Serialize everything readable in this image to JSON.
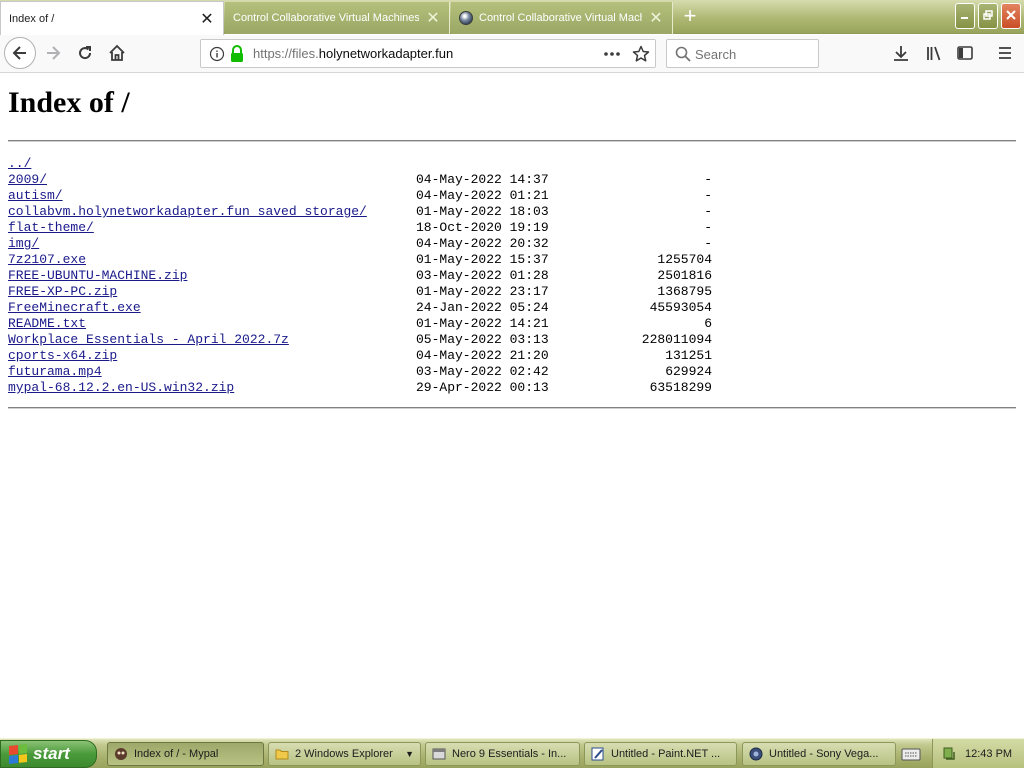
{
  "browser": {
    "tabs": [
      {
        "label": "Index of /",
        "active": true
      },
      {
        "label": "Control Collaborative Virtual Machines!",
        "active": false
      },
      {
        "label": "Control Collaborative Virtual Machines!",
        "active": false
      }
    ],
    "url_scheme": "https://files.",
    "url_domain": "holynetworkadapter.fun",
    "search_placeholder": "Search",
    "accent_color": "#98a45c"
  },
  "page": {
    "title": "Index of /",
    "entries": [
      {
        "name": "../",
        "date": "",
        "size": ""
      },
      {
        "name": "2009/",
        "date": "04-May-2022 14:37",
        "size": "-"
      },
      {
        "name": "autism/",
        "date": "04-May-2022 01:21",
        "size": "-"
      },
      {
        "name": "collabvm.holynetworkadapter.fun saved storage/",
        "date": "01-May-2022 18:03",
        "size": "-"
      },
      {
        "name": "flat-theme/",
        "date": "18-Oct-2020 19:19",
        "size": "-"
      },
      {
        "name": "img/",
        "date": "04-May-2022 20:32",
        "size": "-"
      },
      {
        "name": "7z2107.exe",
        "date": "01-May-2022 15:37",
        "size": "1255704"
      },
      {
        "name": "FREE-UBUNTU-MACHINE.zip",
        "date": "03-May-2022 01:28",
        "size": "2501816"
      },
      {
        "name": "FREE-XP-PC.zip",
        "date": "01-May-2022 23:17",
        "size": "1368795"
      },
      {
        "name": "FreeMinecraft.exe",
        "date": "24-Jan-2022 05:24",
        "size": "45593054"
      },
      {
        "name": "README.txt",
        "date": "01-May-2022 14:21",
        "size": "6"
      },
      {
        "name": "Workplace Essentials - April 2022.7z",
        "date": "05-May-2022 03:13",
        "size": "228011094"
      },
      {
        "name": "cports-x64.zip",
        "date": "04-May-2022 21:20",
        "size": "131251"
      },
      {
        "name": "futurama.mp4",
        "date": "03-May-2022 02:42",
        "size": "629924"
      },
      {
        "name": "mypal-68.12.2.en-US.win32.zip",
        "date": "29-Apr-2022 00:13",
        "size": "63518299"
      }
    ]
  },
  "taskbar": {
    "start_label": "start",
    "items": [
      {
        "label": "Index of / - Mypal",
        "icon": "mypal-icon",
        "active": true
      },
      {
        "label": "2 Windows Explorer",
        "icon": "folder-icon",
        "active": false
      },
      {
        "label": "Nero 9 Essentials - In...",
        "icon": "nero-icon",
        "active": false
      },
      {
        "label": "Untitled - Paint.NET ...",
        "icon": "paintnet-icon",
        "active": false
      },
      {
        "label": "Untitled - Sony Vega...",
        "icon": "vegas-icon",
        "active": false
      }
    ],
    "clock": "12:43 PM"
  }
}
